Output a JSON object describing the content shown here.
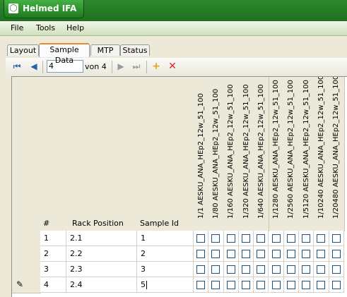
{
  "window": {
    "title": "Helmed IFA",
    "logo_icon": "bottle-icon"
  },
  "menu": [
    "File",
    "Tools",
    "Help"
  ],
  "tabs": [
    {
      "label": "Layout",
      "active": false
    },
    {
      "label": "Sample Data",
      "active": true
    },
    {
      "label": "MTP",
      "active": false
    },
    {
      "label": "Status",
      "active": false
    }
  ],
  "navigator": {
    "position": "4",
    "of_label": "von 4",
    "icons": [
      "first-icon",
      "prev-icon",
      "next-icon",
      "last-icon",
      "add-icon",
      "delete-icon"
    ],
    "colors": {
      "nav": "#2a5db0",
      "add": "#e8a016",
      "delete": "#e0281e",
      "disabled": "#9a9a9a"
    }
  },
  "grid": {
    "headers": {
      "num": "#",
      "rack": "Rack Position",
      "sample": "Sample Id"
    },
    "dilutions": [
      "1/1   AESKU_ANA_HEp2_12w_51_100",
      "1/80   AESKU_ANA_HEp2_12w_51_100",
      "1/160   AESKU_ANA_HEp2_12w_51_100",
      "1/320   AESKU_ANA_HEp2_12w_51_100",
      "1/640   AESKU_ANA_HEp2_12w_51_100",
      "1/1280   AESKU_ANA_HEp2_12w_51_100",
      "1/2560   AESKU_ANA_HEp2_12w_51_100",
      "1/5120   AESKU_ANA_HEp2_12w_51_100",
      "1/10240   AESKU_ANA_HEp2_12w_51_100",
      "1/20480   AESKU_ANA_HEp2_12w_51_100"
    ],
    "rows": [
      {
        "num": "1",
        "rack": "2.1",
        "sample": "1",
        "editing": false
      },
      {
        "num": "2",
        "rack": "2.2",
        "sample": "2",
        "editing": false
      },
      {
        "num": "3",
        "rack": "2.3",
        "sample": "3",
        "editing": false
      },
      {
        "num": "4",
        "rack": "2.4",
        "sample": "5",
        "editing": true,
        "row_icon": "pencil-icon"
      }
    ]
  }
}
